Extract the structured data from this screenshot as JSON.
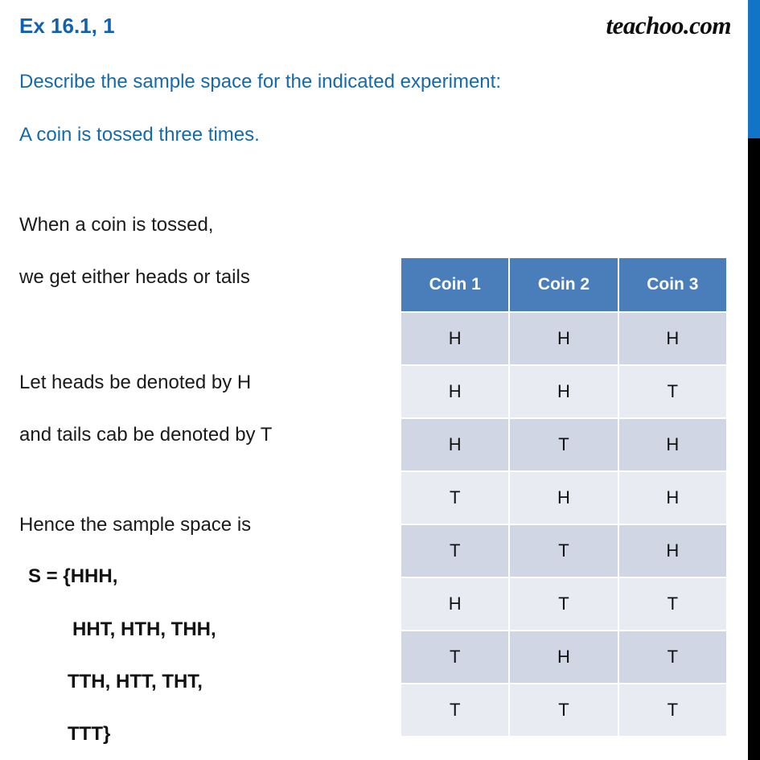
{
  "header": {
    "exercise_title": "Ex 16.1, 1",
    "brand": "teachoo.com"
  },
  "question": {
    "line1": "Describe the sample space for the indicated experiment:",
    "line2": "A coin is tossed three times."
  },
  "explanation": {
    "line1": "When a coin is tossed,",
    "line2": "we get either heads or tails",
    "line3": "Let heads be denoted by H",
    "line4": "and tails cab be denoted by T",
    "line5": "Hence the sample space is"
  },
  "answer": {
    "line1": "S = {HHH,",
    "line2": "HHT, HTH, THH,",
    "line3": "TTH, HTT, THT,",
    "line4": "TTT}"
  },
  "table": {
    "headers": [
      "Coin 1",
      "Coin 2",
      "Coin 3"
    ],
    "rows": [
      [
        "H",
        "H",
        "H"
      ],
      [
        "H",
        "H",
        "T"
      ],
      [
        "H",
        "T",
        "H"
      ],
      [
        "T",
        "H",
        "H"
      ],
      [
        "T",
        "T",
        "H"
      ],
      [
        "H",
        "T",
        "T"
      ],
      [
        "T",
        "H",
        "T"
      ],
      [
        "T",
        "T",
        "T"
      ]
    ]
  },
  "colors": {
    "title_blue": "#1062AE",
    "question_blue": "#1569AD",
    "table_header_blue": "#4A7EBB",
    "row_dark": "#D0D6E4",
    "row_light": "#E8EBF2",
    "accent_bar_blue": "#1274C6",
    "accent_bar_black": "#000000"
  }
}
